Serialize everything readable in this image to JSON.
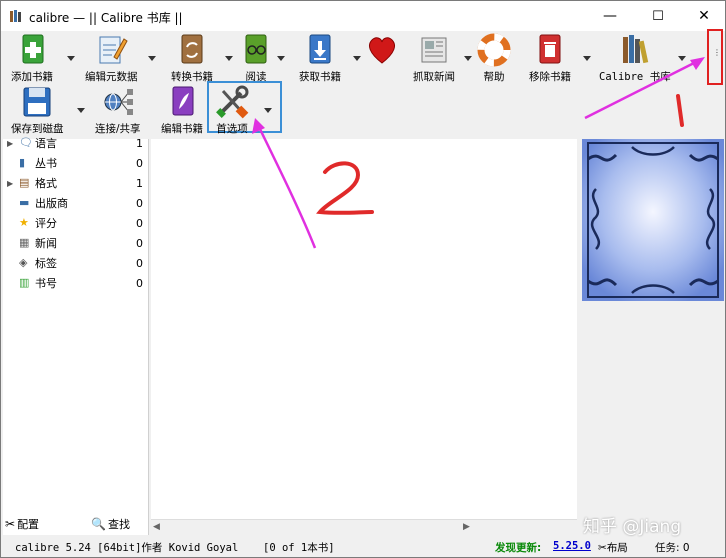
{
  "window": {
    "title": "calibre — || Calibre 书库 ||",
    "minimize_glyph": "—",
    "maximize_glyph": "☐",
    "close_glyph": "✕"
  },
  "toolbar": {
    "add_books": "添加书籍",
    "edit_metadata": "编辑元数据",
    "convert_books": "转换书籍",
    "view": "阅读",
    "get_books": "获取书籍",
    "fetch_news": "抓取新闻",
    "help": "帮助",
    "remove_books": "移除书籍",
    "calibre_library": "Calibre 书库",
    "save_to_disk": "保存到磁盘",
    "connect_share": "连接/共享",
    "edit_book": "编辑书籍",
    "preferences": "首选项"
  },
  "sidebar": {
    "items": [
      {
        "label": "语言",
        "count": "1",
        "icon": "language-icon",
        "expand": "▶"
      },
      {
        "label": "丛书",
        "count": "0",
        "icon": "series-icon",
        "expand": ""
      },
      {
        "label": "格式",
        "count": "1",
        "icon": "formats-icon",
        "expand": "▶"
      },
      {
        "label": "出版商",
        "count": "0",
        "icon": "publisher-icon",
        "expand": ""
      },
      {
        "label": "评分",
        "count": "0",
        "icon": "rating-icon",
        "expand": ""
      },
      {
        "label": "新闻",
        "count": "0",
        "icon": "news-icon",
        "expand": ""
      },
      {
        "label": "标签",
        "count": "0",
        "icon": "tags-icon",
        "expand": ""
      },
      {
        "label": "书号",
        "count": "0",
        "icon": "identifiers-icon",
        "expand": ""
      }
    ],
    "configure": "配置",
    "find": "查找"
  },
  "statusbar": {
    "version": "calibre 5.24 [64bit]作者 Kovid Goyal",
    "book_count": "[0 of 1本书]",
    "update_label": "发现更新:",
    "update_version": "5.25.0",
    "layout": "布局",
    "jobs": "任务: 0"
  },
  "annotations": {
    "num1": "1",
    "num2": "2",
    "watermark": "知乎 @Jiang"
  },
  "colors": {
    "annotation_arrow": "#e030e0",
    "annotation_number": "#e03030",
    "highlight_box": "#3b8fd6",
    "update_green": "#0a8a0a",
    "update_link": "#0000cc"
  }
}
